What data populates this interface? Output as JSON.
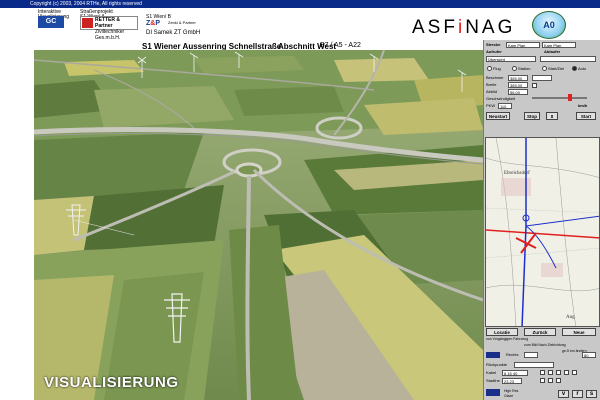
{
  "titlebar": {
    "text": "Copyright (c) 2003, 2004 RTHe, All rights reserved"
  },
  "header": {
    "left_line1": "Interaktive",
    "left_line2": "Visualisierung",
    "project_line1": "Straßenprojekt",
    "project_line2": "S1 Wien/ A",
    "project_short": "S1 Wien/ B",
    "gc_logo": "GC",
    "retter_name": "RETTER & Partner",
    "retter_sub": "Ziviltechniker Ges.m.b.H.",
    "zp_logo_z": "Z",
    "zp_logo_amp": "&",
    "zp_logo_p": "P",
    "zp_sub": "Zenkl & Partner",
    "company": "DI Samek ZT GmbH",
    "headline": "S1 Wiener Aussenring Schnellstraße",
    "abschnitt_label": "Abschnitt West",
    "abschnitt_value": "B7 / A5 - A22",
    "brand_asf": "ASF",
    "brand_i": "i",
    "brand_nag": "NAG",
    "badge": "A0"
  },
  "sidebar": {
    "strecke_label": "Strecke",
    "strecke_opt1": "Kam Plan",
    "strecke_opt2": "Kam Plan",
    "aufrufer_label": "Aufrufer",
    "ablaufer_label": "Ablaufer",
    "uebersicht": "Übersicht",
    "flug_label": "Flug",
    "station_label": "Station",
    "start_ziel_label": "Start/Ziel",
    "auto_label": "Auto",
    "beschwer_label": "Beschwer",
    "beschwer_val": "365,00",
    "breite_label": "Breite",
    "breite_val": "365,00",
    "abbild_label": "Abbild",
    "abbild_val": "56,00",
    "speed_label": "Geschwindigkeit",
    "pkw_label": "PKW",
    "pkw_val": "110",
    "speed_unit": "km/h",
    "btn_neustart": "Neustart",
    "btn_stop": "Stop",
    "btn_play": "II",
    "btn_start": "Start",
    "btn_loecken": "Locatie",
    "btn_zurueck": "Zurück",
    "btn_neu": "Neue",
    "sub1": "von Vorgängigen Fahrzeug",
    "sub2": "zum Bild Nach Zielrichtung",
    "sub3": "ge-5 km ändern",
    "rechts_label": "Rechts",
    "rechts_val": "80",
    "rueckpunkt_label": "Rückpunkte",
    "kabel_label": "Kabel",
    "kabel_val": "8 15 40",
    "stadthaus_label": "Stadthe",
    "stadthaus_val": "23 23",
    "status_label": "High Res",
    "status_sub": "Glaze",
    "vrs_v": "v",
    "vrs_r": "r",
    "vrs_s": "s"
  },
  "map": {
    "place1": "Ebreichsdorf",
    "place2": "Aug"
  },
  "viewport": {
    "caption": "VISUALISIERUNG"
  },
  "colors": {
    "titlebar": "#0a2a8a",
    "asfinag_accent": "#d22222",
    "sidebar_bg": "#c8c8c8",
    "route_red": "#e02020",
    "route_blue": "#1b2fd0"
  }
}
